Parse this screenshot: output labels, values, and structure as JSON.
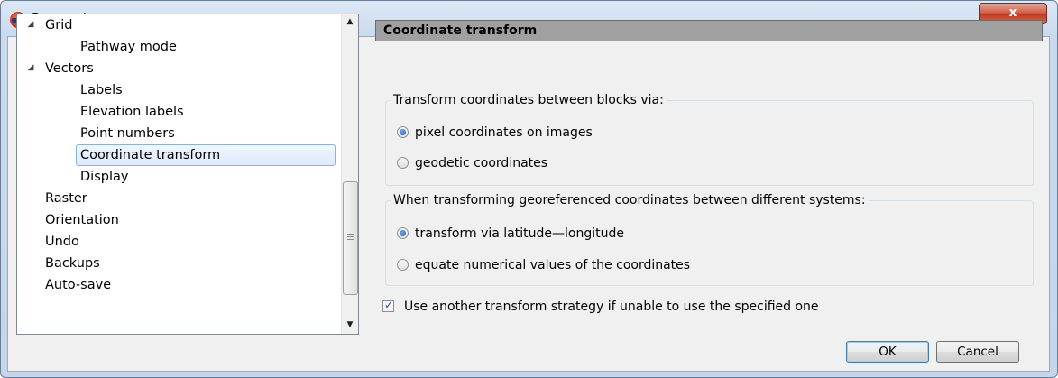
{
  "window": {
    "title": "Parameters",
    "close_label": "x"
  },
  "tree": {
    "items": [
      {
        "label": "Grid",
        "expanded": true
      },
      {
        "label": "Pathway mode"
      },
      {
        "label": "Vectors",
        "expanded": true
      },
      {
        "label": "Labels"
      },
      {
        "label": "Elevation labels"
      },
      {
        "label": "Point numbers"
      },
      {
        "label": "Coordinate transform",
        "selected": true
      },
      {
        "label": "Display"
      },
      {
        "label": "Raster"
      },
      {
        "label": "Orientation"
      },
      {
        "label": "Undo"
      },
      {
        "label": "Backups"
      },
      {
        "label": "Auto-save"
      }
    ]
  },
  "panel": {
    "title": "Coordinate transform",
    "group1": {
      "caption": "Transform coordinates between blocks via:",
      "options": [
        "pixel coordinates on images",
        "geodetic coordinates"
      ],
      "selected_index": 0
    },
    "group2": {
      "caption": "When transforming georeferenced coordinates between different systems:",
      "options": [
        "transform via latitude—longitude",
        "equate numerical values of the coordinates"
      ],
      "selected_index": 0
    },
    "fallback_checkbox": {
      "label": "Use another transform strategy if unable to use the specified one",
      "checked": true
    }
  },
  "buttons": {
    "ok": "OK",
    "cancel": "Cancel"
  },
  "icons": {
    "expander": "triangle-down-icon",
    "scroll_up": "arrow-up-icon",
    "scroll_down": "arrow-down-icon"
  },
  "colors": {
    "header_bg": "#a0a0a0",
    "selection_border": "#8ab2e0",
    "close_button": "#c03a1f"
  }
}
